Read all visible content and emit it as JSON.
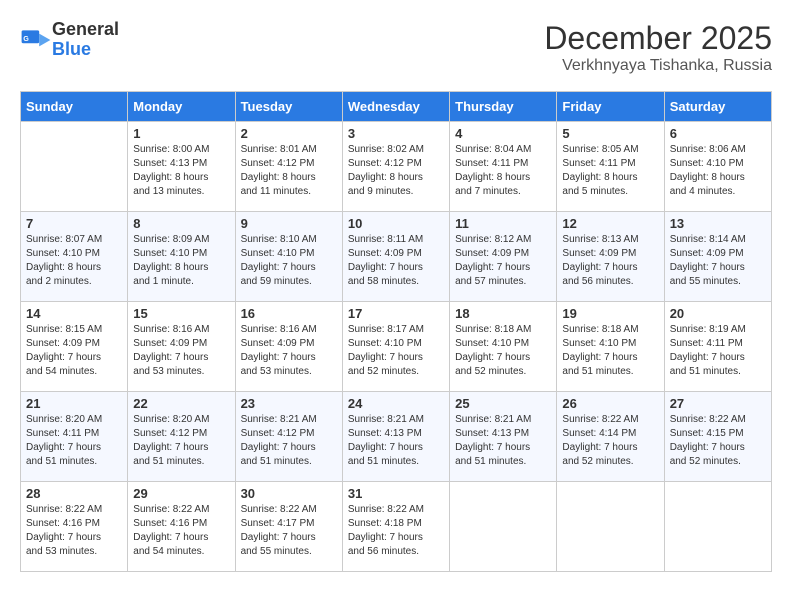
{
  "logo": {
    "general": "General",
    "blue": "Blue"
  },
  "header": {
    "month": "December 2025",
    "location": "Verkhnyaya Tishanka, Russia"
  },
  "weekdays": [
    "Sunday",
    "Monday",
    "Tuesday",
    "Wednesday",
    "Thursday",
    "Friday",
    "Saturday"
  ],
  "weeks": [
    [
      {
        "day": "",
        "detail": ""
      },
      {
        "day": "1",
        "detail": "Sunrise: 8:00 AM\nSunset: 4:13 PM\nDaylight: 8 hours\nand 13 minutes."
      },
      {
        "day": "2",
        "detail": "Sunrise: 8:01 AM\nSunset: 4:12 PM\nDaylight: 8 hours\nand 11 minutes."
      },
      {
        "day": "3",
        "detail": "Sunrise: 8:02 AM\nSunset: 4:12 PM\nDaylight: 8 hours\nand 9 minutes."
      },
      {
        "day": "4",
        "detail": "Sunrise: 8:04 AM\nSunset: 4:11 PM\nDaylight: 8 hours\nand 7 minutes."
      },
      {
        "day": "5",
        "detail": "Sunrise: 8:05 AM\nSunset: 4:11 PM\nDaylight: 8 hours\nand 5 minutes."
      },
      {
        "day": "6",
        "detail": "Sunrise: 8:06 AM\nSunset: 4:10 PM\nDaylight: 8 hours\nand 4 minutes."
      }
    ],
    [
      {
        "day": "7",
        "detail": "Sunrise: 8:07 AM\nSunset: 4:10 PM\nDaylight: 8 hours\nand 2 minutes."
      },
      {
        "day": "8",
        "detail": "Sunrise: 8:09 AM\nSunset: 4:10 PM\nDaylight: 8 hours\nand 1 minute."
      },
      {
        "day": "9",
        "detail": "Sunrise: 8:10 AM\nSunset: 4:10 PM\nDaylight: 7 hours\nand 59 minutes."
      },
      {
        "day": "10",
        "detail": "Sunrise: 8:11 AM\nSunset: 4:09 PM\nDaylight: 7 hours\nand 58 minutes."
      },
      {
        "day": "11",
        "detail": "Sunrise: 8:12 AM\nSunset: 4:09 PM\nDaylight: 7 hours\nand 57 minutes."
      },
      {
        "day": "12",
        "detail": "Sunrise: 8:13 AM\nSunset: 4:09 PM\nDaylight: 7 hours\nand 56 minutes."
      },
      {
        "day": "13",
        "detail": "Sunrise: 8:14 AM\nSunset: 4:09 PM\nDaylight: 7 hours\nand 55 minutes."
      }
    ],
    [
      {
        "day": "14",
        "detail": "Sunrise: 8:15 AM\nSunset: 4:09 PM\nDaylight: 7 hours\nand 54 minutes."
      },
      {
        "day": "15",
        "detail": "Sunrise: 8:16 AM\nSunset: 4:09 PM\nDaylight: 7 hours\nand 53 minutes."
      },
      {
        "day": "16",
        "detail": "Sunrise: 8:16 AM\nSunset: 4:09 PM\nDaylight: 7 hours\nand 53 minutes."
      },
      {
        "day": "17",
        "detail": "Sunrise: 8:17 AM\nSunset: 4:10 PM\nDaylight: 7 hours\nand 52 minutes."
      },
      {
        "day": "18",
        "detail": "Sunrise: 8:18 AM\nSunset: 4:10 PM\nDaylight: 7 hours\nand 52 minutes."
      },
      {
        "day": "19",
        "detail": "Sunrise: 8:18 AM\nSunset: 4:10 PM\nDaylight: 7 hours\nand 51 minutes."
      },
      {
        "day": "20",
        "detail": "Sunrise: 8:19 AM\nSunset: 4:11 PM\nDaylight: 7 hours\nand 51 minutes."
      }
    ],
    [
      {
        "day": "21",
        "detail": "Sunrise: 8:20 AM\nSunset: 4:11 PM\nDaylight: 7 hours\nand 51 minutes."
      },
      {
        "day": "22",
        "detail": "Sunrise: 8:20 AM\nSunset: 4:12 PM\nDaylight: 7 hours\nand 51 minutes."
      },
      {
        "day": "23",
        "detail": "Sunrise: 8:21 AM\nSunset: 4:12 PM\nDaylight: 7 hours\nand 51 minutes."
      },
      {
        "day": "24",
        "detail": "Sunrise: 8:21 AM\nSunset: 4:13 PM\nDaylight: 7 hours\nand 51 minutes."
      },
      {
        "day": "25",
        "detail": "Sunrise: 8:21 AM\nSunset: 4:13 PM\nDaylight: 7 hours\nand 51 minutes."
      },
      {
        "day": "26",
        "detail": "Sunrise: 8:22 AM\nSunset: 4:14 PM\nDaylight: 7 hours\nand 52 minutes."
      },
      {
        "day": "27",
        "detail": "Sunrise: 8:22 AM\nSunset: 4:15 PM\nDaylight: 7 hours\nand 52 minutes."
      }
    ],
    [
      {
        "day": "28",
        "detail": "Sunrise: 8:22 AM\nSunset: 4:16 PM\nDaylight: 7 hours\nand 53 minutes."
      },
      {
        "day": "29",
        "detail": "Sunrise: 8:22 AM\nSunset: 4:16 PM\nDaylight: 7 hours\nand 54 minutes."
      },
      {
        "day": "30",
        "detail": "Sunrise: 8:22 AM\nSunset: 4:17 PM\nDaylight: 7 hours\nand 55 minutes."
      },
      {
        "day": "31",
        "detail": "Sunrise: 8:22 AM\nSunset: 4:18 PM\nDaylight: 7 hours\nand 56 minutes."
      },
      {
        "day": "",
        "detail": ""
      },
      {
        "day": "",
        "detail": ""
      },
      {
        "day": "",
        "detail": ""
      }
    ]
  ]
}
